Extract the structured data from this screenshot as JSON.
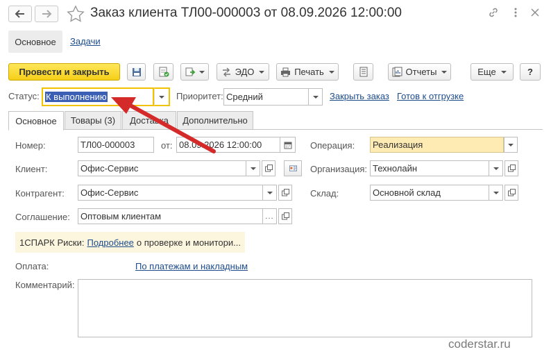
{
  "window": {
    "title": "Заказ клиента ТЛ00-000003 от 08.09.2026 12:00:00",
    "icons": [
      "back-arrow-icon",
      "forward-arrow-icon",
      "star-icon",
      "link-icon",
      "more-icon",
      "close-icon"
    ]
  },
  "sections": {
    "main": "Основное",
    "tasks": "Задачи"
  },
  "toolbar": {
    "post_close": "Провести и закрыть",
    "edo": "ЭДО",
    "print": "Печать",
    "reports": "Отчеты",
    "more": "Еще",
    "help": "?"
  },
  "header": {
    "status_label": "Статус:",
    "status_value": "К выполнению",
    "priority_label": "Приоритет:",
    "priority_value": "Средний",
    "close_order": "Закрыть заказ",
    "ready_ship": "Готов к отгрузке"
  },
  "tabs": [
    "Основное",
    "Товары (3)",
    "Доставка",
    "Дополнительно"
  ],
  "form": {
    "number_label": "Номер:",
    "number_value": "ТЛ00-000003",
    "date_label": "от:",
    "date_value": "08.09.2026 12:00:00",
    "operation_label": "Операция:",
    "operation_value": "Реализация",
    "client_label": "Клиент:",
    "client_value": "Офис-Сервис",
    "org_label": "Организация:",
    "org_value": "Технолайн",
    "contractor_label": "Контрагент:",
    "contractor_value": "Офис-Сервис",
    "warehouse_label": "Склад:",
    "warehouse_value": "Основной склад",
    "agreement_label": "Соглашение:",
    "agreement_value": "Оптовым клиентам",
    "spark_prefix": "1СПАРК Риски:",
    "spark_link": "Подробнее",
    "spark_suffix": "о проверке и монитори...",
    "payment_label": "Оплата:",
    "payment_link": "По платежам и накладным",
    "comment_label": "Комментарий:",
    "comment_value": ""
  },
  "watermark": "coderstar.ru",
  "colors": {
    "accent_yellow": "#f5cf19",
    "link_blue": "#1d4c8c",
    "arrow_red": "#d42a2a",
    "selection_blue": "#3a5fb4"
  }
}
